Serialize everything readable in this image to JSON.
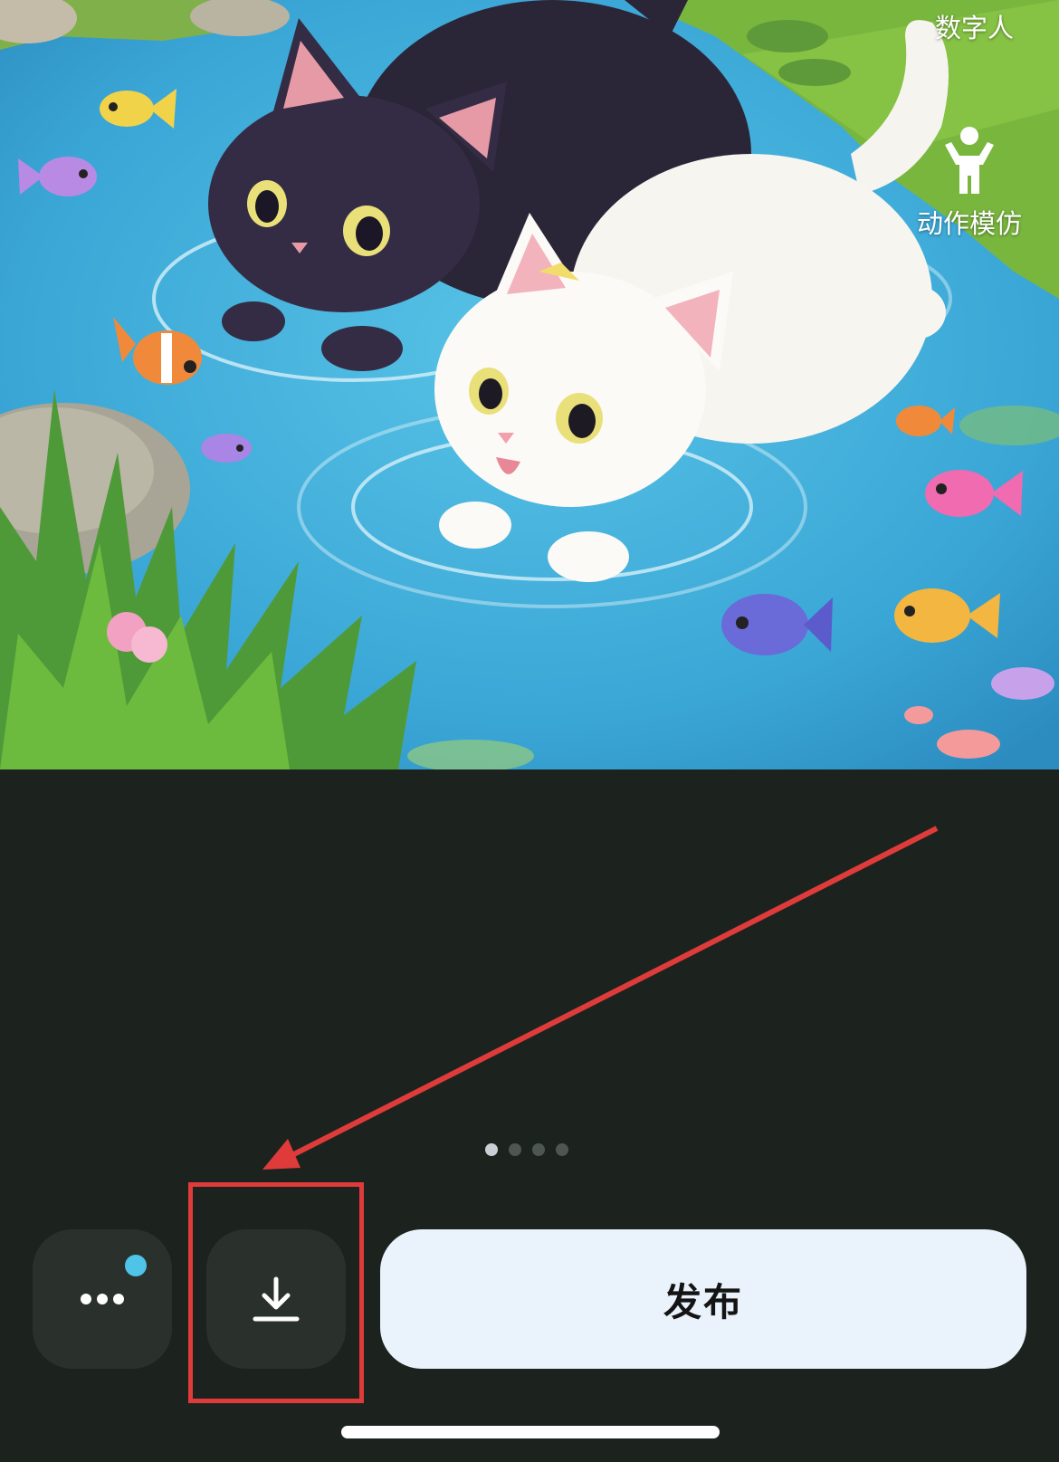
{
  "overlay": {
    "digital_human_label": "数字人",
    "mimic_label": "动作模仿",
    "mimic_icon": "person-pose-icon"
  },
  "pager": {
    "total": 4,
    "current": 1
  },
  "toolbar": {
    "more_icon": "more-dots-icon",
    "download_icon": "download-icon",
    "publish_label": "发布"
  },
  "colors": {
    "background": "#1c231e",
    "button_dark": "#2a302c",
    "publish_bg": "#eaf3fc",
    "notification_dot": "#4fc3e8",
    "annotation_red": "#e03b3b"
  }
}
